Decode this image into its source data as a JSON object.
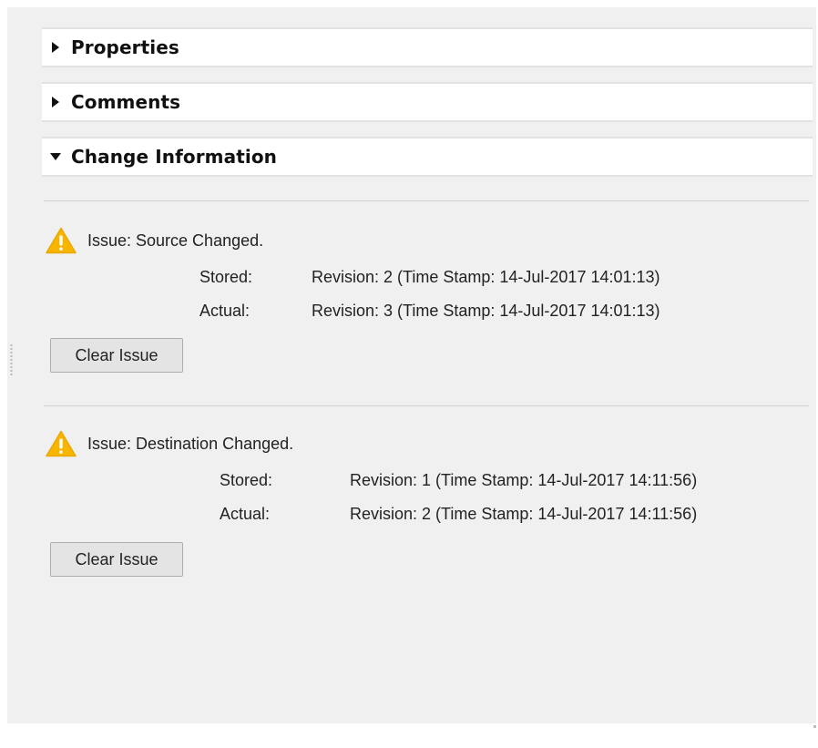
{
  "sections": [
    {
      "title": "Properties",
      "expanded": false,
      "icon": "triangle-right-icon"
    },
    {
      "title": "Comments",
      "expanded": false,
      "icon": "triangle-right-icon"
    },
    {
      "title": "Change Information",
      "expanded": true,
      "icon": "triangle-down-icon"
    }
  ],
  "issues": [
    {
      "title": "Issue: Source Changed.",
      "icon": "warning-icon",
      "stored_label": "Stored:",
      "stored_value": "Revision: 2 (Time Stamp: 14-Jul-2017 14:01:13)",
      "actual_label": "Actual:",
      "actual_value": "Revision: 3 (Time Stamp: 14-Jul-2017 14:01:13)",
      "button_label": "Clear Issue"
    },
    {
      "title": "Issue: Destination Changed.",
      "icon": "warning-icon",
      "stored_label": "Stored:",
      "stored_value": "Revision: 1 (Time Stamp: 14-Jul-2017 14:11:56)",
      "actual_label": "Actual:",
      "actual_value": "Revision: 2 (Time Stamp: 14-Jul-2017 14:11:56)",
      "button_label": "Clear Issue"
    }
  ],
  "colors": {
    "panel_background": "#f0f0f0",
    "warning_fill": "#f7b500",
    "header_background": "#ffffff"
  }
}
